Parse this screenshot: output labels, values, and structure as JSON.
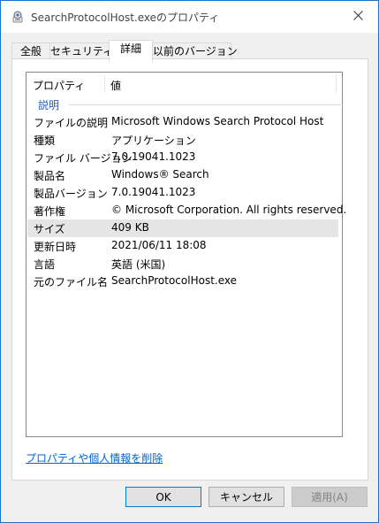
{
  "window": {
    "title": "SearchProtocolHost.exeのプロパティ",
    "app_icon": "file-properties-icon",
    "close_icon": "close-icon"
  },
  "tabs": [
    {
      "label": "全般",
      "active": false
    },
    {
      "label": "セキュリティ",
      "active": false
    },
    {
      "label": "詳細",
      "active": true
    },
    {
      "label": "以前のバージョン",
      "active": false
    }
  ],
  "details": {
    "columns": {
      "property": "プロパティ",
      "value": "値"
    },
    "group": "説明",
    "rows": [
      {
        "key": "ファイルの説明",
        "value": "Microsoft Windows Search Protocol Host"
      },
      {
        "key": "種類",
        "value": "アプリケーション"
      },
      {
        "key": "ファイル バージョン",
        "value": "7.0.19041.1023"
      },
      {
        "key": "製品名",
        "value": "Windows® Search"
      },
      {
        "key": "製品バージョン",
        "value": "7.0.19041.1023"
      },
      {
        "key": "著作権",
        "value": "© Microsoft Corporation. All rights reserved."
      },
      {
        "key": "サイズ",
        "value": "409 KB"
      },
      {
        "key": "更新日時",
        "value": "2021/06/11 18:08"
      },
      {
        "key": "言語",
        "value": "英語 (米国)"
      },
      {
        "key": "元のファイル名",
        "value": "SearchProtocolHost.exe"
      }
    ]
  },
  "link": {
    "remove_properties": "プロパティや個人情報を削除"
  },
  "buttons": {
    "ok": "OK",
    "cancel": "キャンセル",
    "apply": "適用(A)"
  },
  "colors": {
    "accent": "#0078d7",
    "link": "#0066cc",
    "group": "#1e5ebd"
  }
}
